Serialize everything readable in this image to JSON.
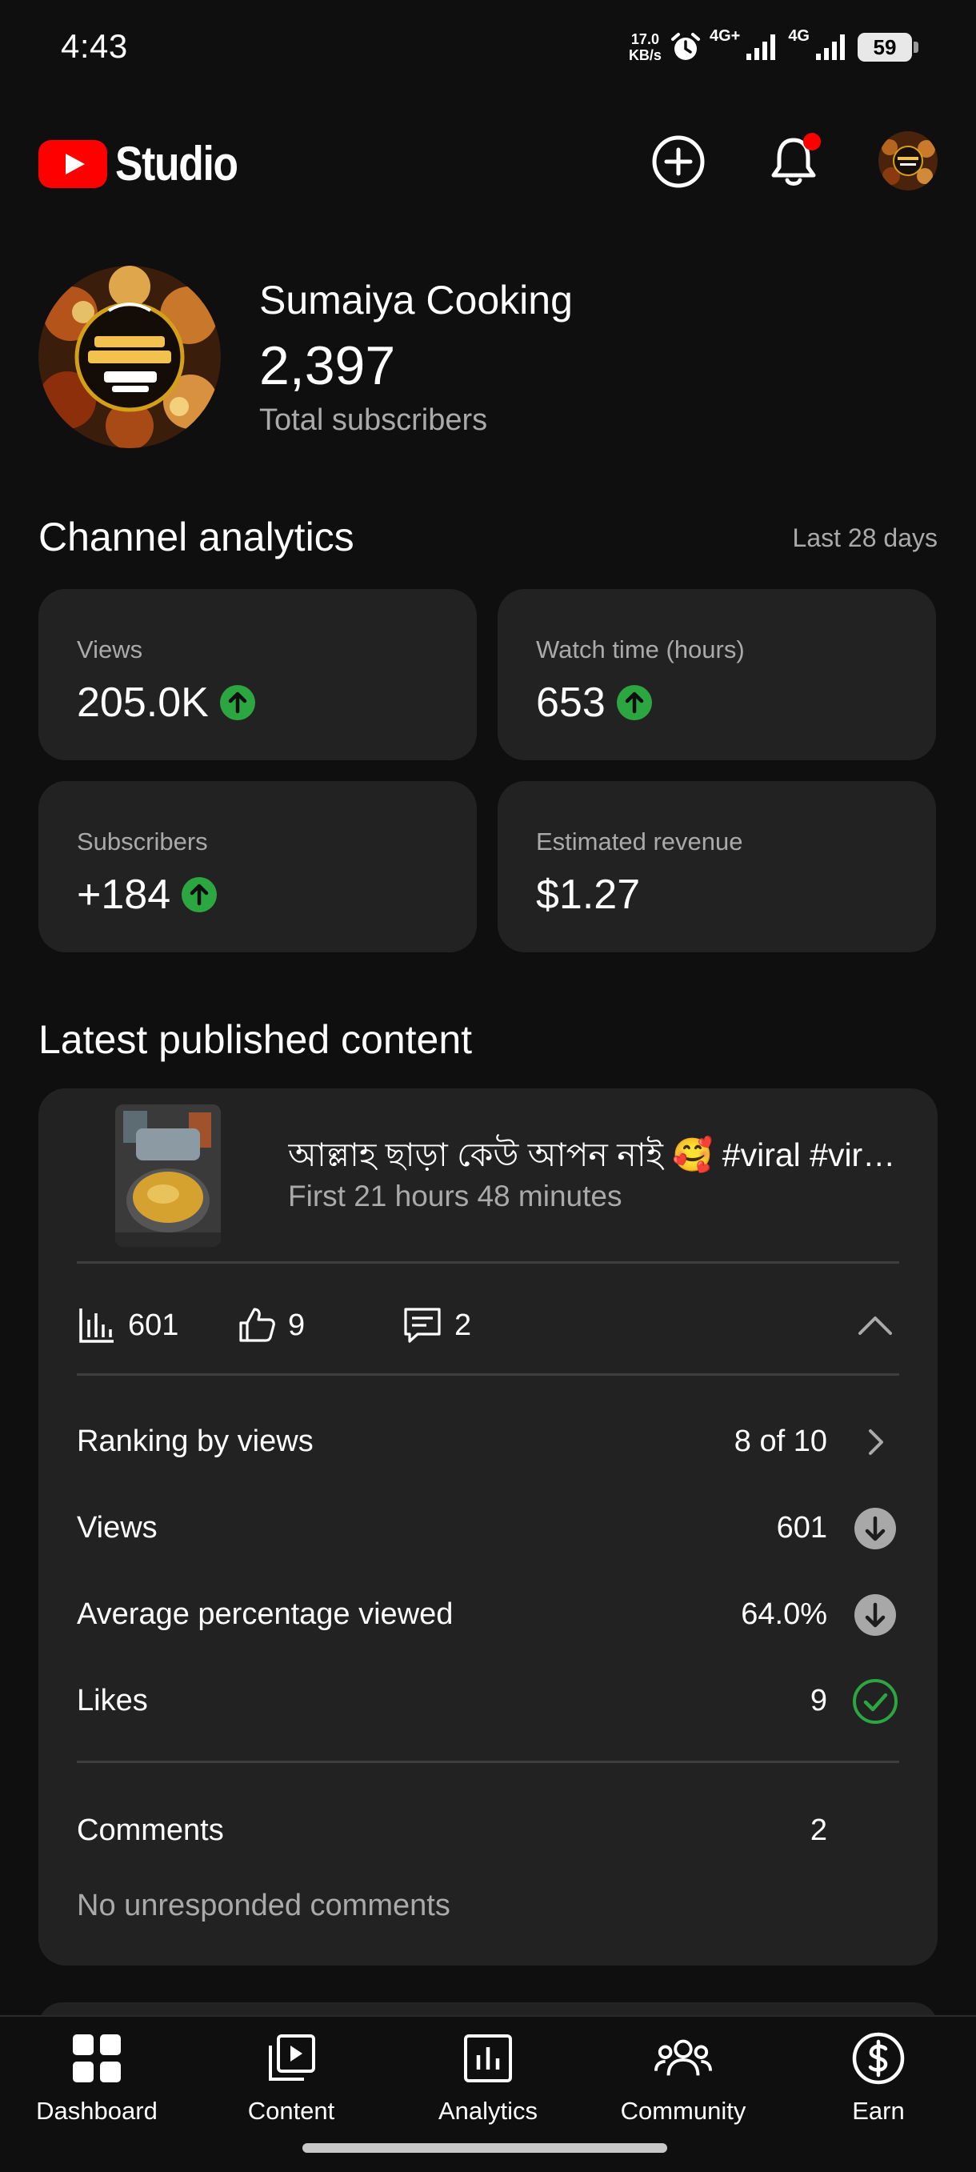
{
  "status_bar": {
    "time": "4:43",
    "net_speed_value": "17.0",
    "net_speed_unit": "KB/s",
    "signal1_label": "4G+",
    "signal2_label": "4G",
    "battery": "59"
  },
  "header": {
    "logo_text": "Studio",
    "icons": [
      "create-icon",
      "notifications-icon",
      "account-avatar"
    ],
    "notification_dot_color": "#ff0000"
  },
  "channel": {
    "name": "Sumaiya Cooking",
    "subscribers": "2,397",
    "subscribers_label": "Total subscribers"
  },
  "analytics": {
    "title": "Channel analytics",
    "range": "Last 28 days",
    "metrics": [
      {
        "label": "Views",
        "value": "205.0K",
        "trend": "up"
      },
      {
        "label": "Watch time (hours)",
        "value": "653",
        "trend": "up"
      },
      {
        "label": "Subscribers",
        "value": "+184",
        "trend": "up"
      },
      {
        "label": "Estimated revenue",
        "value": "$1.27",
        "trend": ""
      }
    ],
    "trend_up_color": "#2ba640"
  },
  "latest": {
    "title": "Latest published content",
    "video_title": "আল্লাহ ছাড়া কেউ আপন নাই 🥰 #viral #viral…",
    "video_subtitle": "First 21 hours 48 minutes",
    "stats": {
      "views": "601",
      "likes": "9",
      "comments": "2"
    },
    "rows": [
      {
        "label": "Ranking by views",
        "value": "8 of 10",
        "icon": "chevron-right-icon"
      },
      {
        "label": "Views",
        "value": "601",
        "icon": "arrow-down-icon"
      },
      {
        "label": "Average percentage viewed",
        "value": "64.0%",
        "icon": "arrow-down-icon"
      },
      {
        "label": "Likes",
        "value": "9",
        "icon": "check-circle-icon"
      }
    ],
    "comments_label": "Comments",
    "comments_value": "2",
    "no_unresponded": "No unresponded comments"
  },
  "bottom_nav": [
    {
      "label": "Dashboard",
      "icon": "dashboard-icon"
    },
    {
      "label": "Content",
      "icon": "content-icon"
    },
    {
      "label": "Analytics",
      "icon": "analytics-icon"
    },
    {
      "label": "Community",
      "icon": "community-icon"
    },
    {
      "label": "Earn",
      "icon": "earn-icon"
    }
  ]
}
